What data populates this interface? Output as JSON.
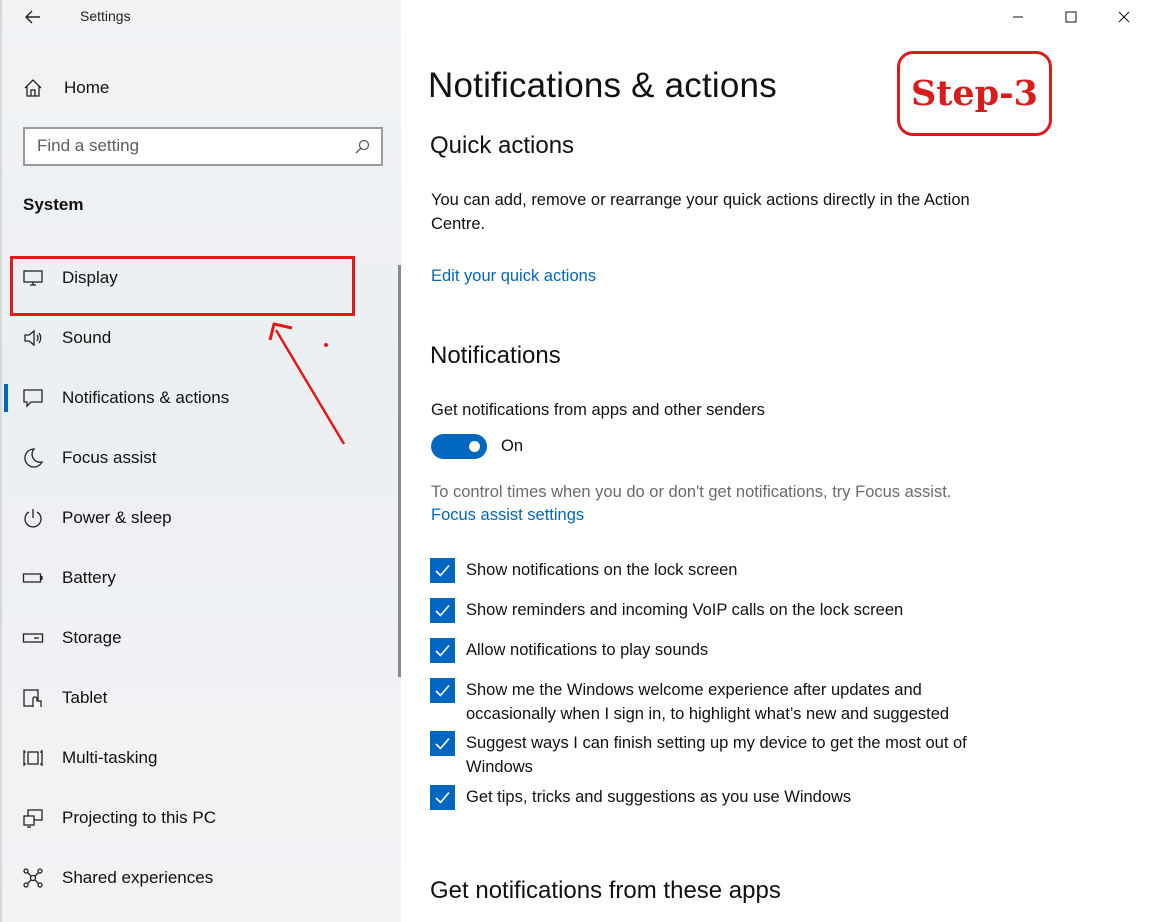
{
  "window": {
    "title": "Settings"
  },
  "sidebar": {
    "home_label": "Home",
    "search_placeholder": "Find a setting",
    "section_title": "System",
    "items": [
      {
        "label": "Display",
        "icon": "monitor-icon"
      },
      {
        "label": "Sound",
        "icon": "speaker-icon"
      },
      {
        "label": "Notifications & actions",
        "icon": "message-icon",
        "selected": true
      },
      {
        "label": "Focus assist",
        "icon": "moon-icon"
      },
      {
        "label": "Power & sleep",
        "icon": "power-icon"
      },
      {
        "label": "Battery",
        "icon": "battery-icon"
      },
      {
        "label": "Storage",
        "icon": "drive-icon"
      },
      {
        "label": "Tablet",
        "icon": "tablet-icon"
      },
      {
        "label": "Multi-tasking",
        "icon": "multitask-icon"
      },
      {
        "label": "Projecting to this PC",
        "icon": "projector-icon"
      },
      {
        "label": "Shared experiences",
        "icon": "share-icon"
      }
    ]
  },
  "annotation": {
    "step_label": "Step-3",
    "color": "#d81c1c"
  },
  "main": {
    "page_title": "Notifications & actions",
    "quick_actions": {
      "heading": "Quick actions",
      "description": "You can add, remove or rearrange your quick actions directly in the Action Centre.",
      "link": "Edit your quick actions"
    },
    "notifications": {
      "heading": "Notifications",
      "toggle_caption": "Get notifications from apps and other senders",
      "toggle_state": "On",
      "hint": "To control times when you do or don't get notifications, try Focus assist.",
      "focus_link": "Focus assist settings",
      "checkboxes": [
        {
          "label": "Show notifications on the lock screen",
          "checked": true
        },
        {
          "label": "Show reminders and incoming VoIP calls on the lock screen",
          "checked": true
        },
        {
          "label": "Allow notifications to play sounds",
          "checked": true
        },
        {
          "label": "Show me the Windows welcome experience after updates and occasionally when I sign in, to highlight what’s new and suggested",
          "checked": true
        },
        {
          "label": "Suggest ways I can finish setting up my device to get the most out of Windows",
          "checked": true
        },
        {
          "label": "Get tips, tricks and suggestions as you use Windows",
          "checked": true
        }
      ]
    },
    "apps_heading": "Get notifications from these apps"
  },
  "colors": {
    "accent": "#0067c0",
    "link": "#0067b8",
    "annotation": "#e01919"
  }
}
